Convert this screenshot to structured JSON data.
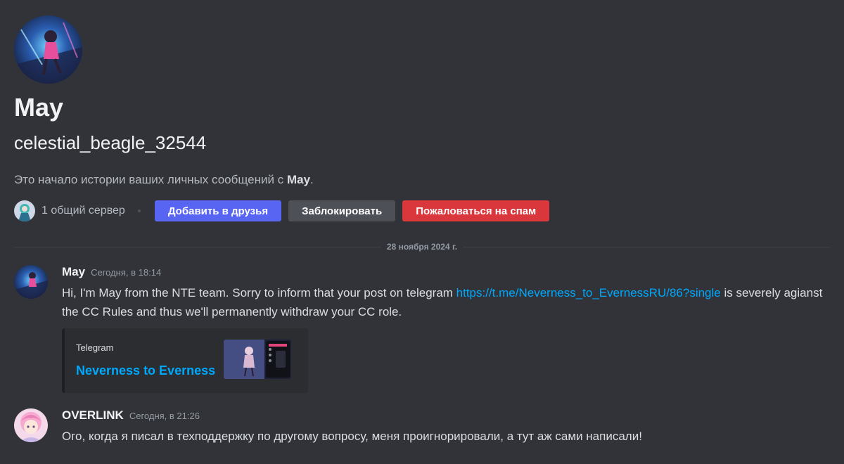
{
  "intro": {
    "display_name": "May",
    "username": "celestial_beagle_32544",
    "history_text": "Это начало истории ваших личных сообщений с ",
    "history_name": "May",
    "history_end": "."
  },
  "actions": {
    "mutual_servers": "1 общий сервер",
    "add_friend": "Добавить в друзья",
    "block": "Заблокировать",
    "report_spam": "Пожаловаться на спам"
  },
  "date_divider": "28 ноября 2024 г.",
  "messages": [
    {
      "author": "May",
      "time": "Сегодня, в 18:14",
      "text_before": "Hi, I'm May from the NTE team. Sorry to inform that your post on telegram ",
      "link": "https://t.me/Neverness_to_EvernessRU/86?single",
      "text_after": "  is severely agianst the CC Rules and thus we'll permanently withdraw your CC role.",
      "embed": {
        "provider": "Telegram",
        "title": "Neverness to Everness"
      }
    },
    {
      "author": "OVERLINK",
      "time": "Сегодня, в 21:26",
      "text": "Ого, когда я писал в техподдержку по другому вопросу, меня проигнорировали, а тут аж сами написали!"
    }
  ],
  "colors": {
    "background": "#313338",
    "primary": "#5865f2",
    "secondary": "#4e5058",
    "danger": "#da373c",
    "link": "#00a8fc"
  },
  "icons": {
    "profile_avatar": "may-avatar-icon",
    "mutual_server": "server-icon",
    "overlink_avatar": "overlink-avatar-icon"
  }
}
